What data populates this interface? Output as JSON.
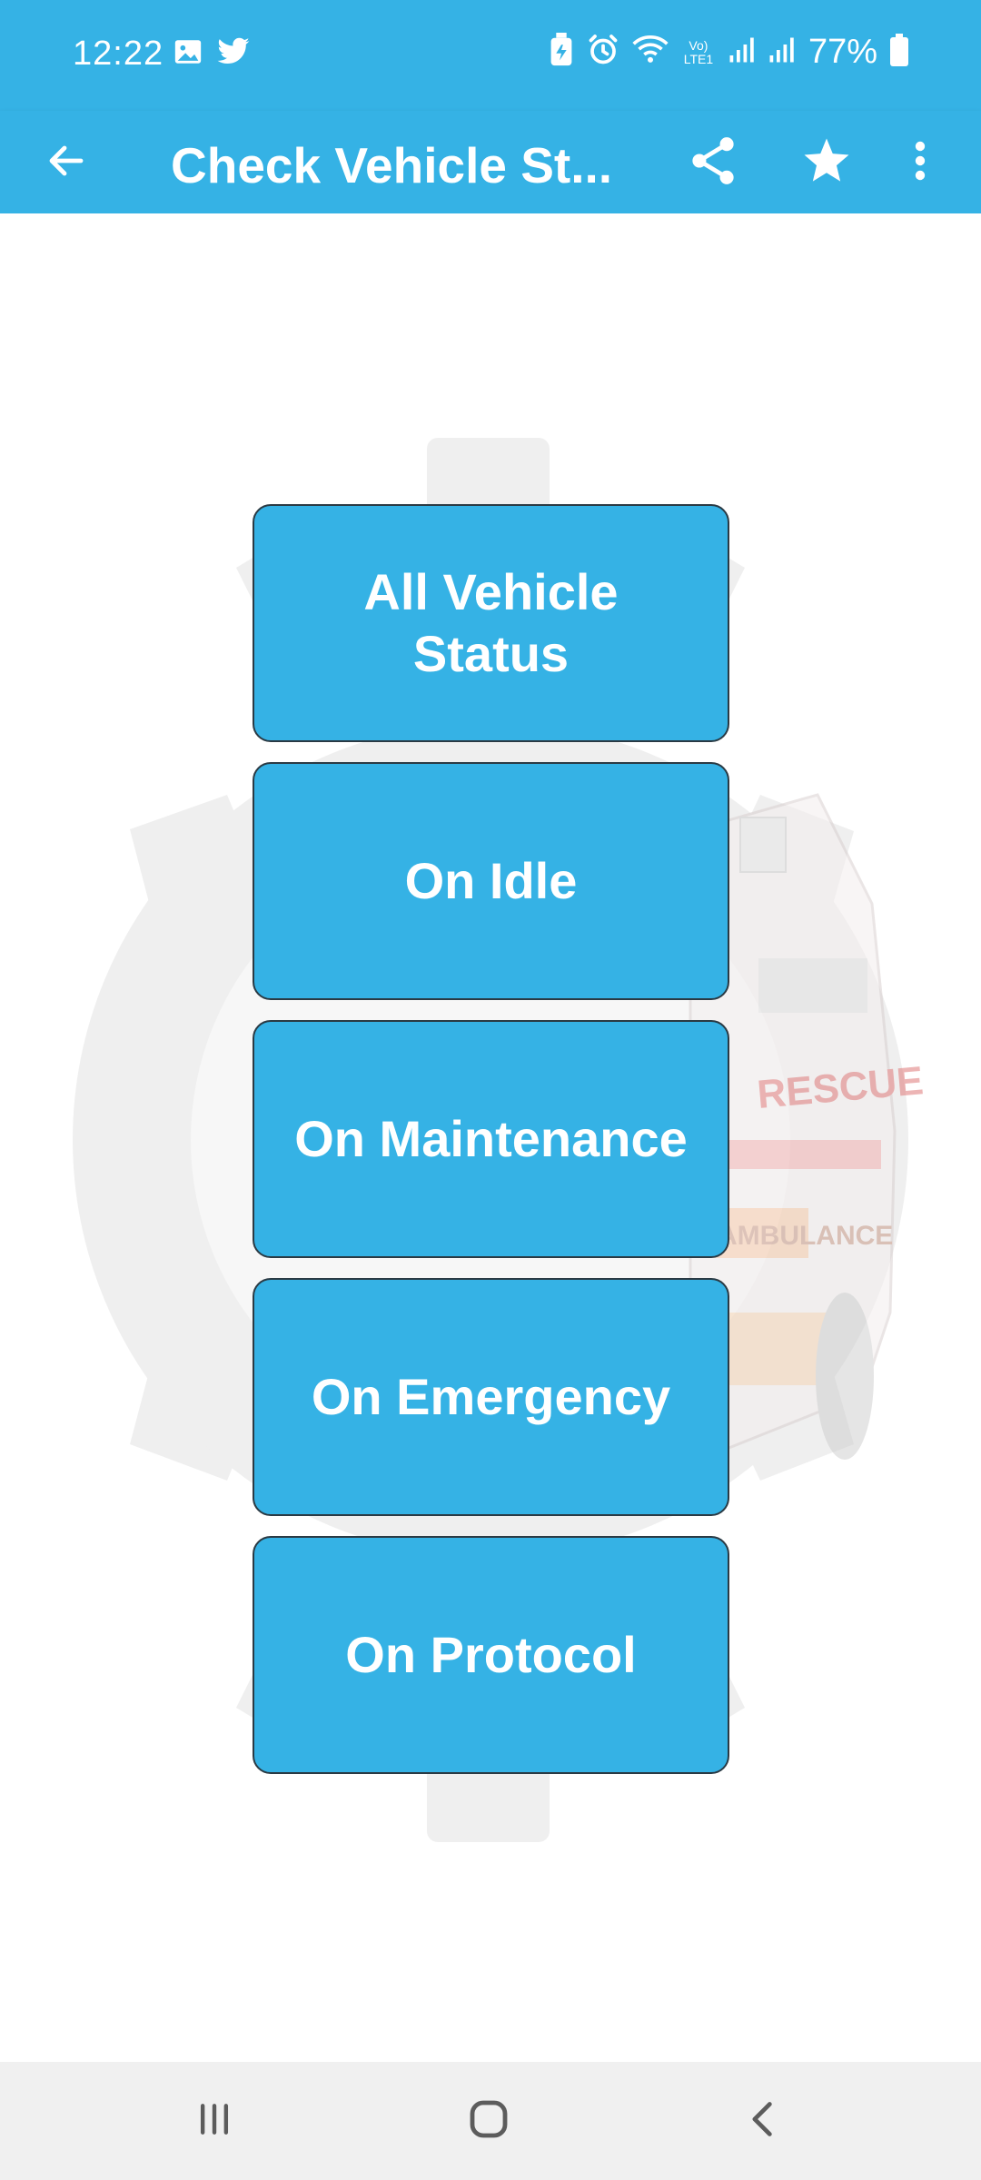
{
  "status_bar": {
    "time": "12:22",
    "battery": "77%",
    "network": "Vo) LTE1"
  },
  "app_bar": {
    "title": "Check Vehicle St...",
    "icons": [
      "arrow-left-icon",
      "share-icon",
      "star-icon",
      "more-vertical-icon"
    ]
  },
  "background": {
    "van_text_1": "RESCUE",
    "van_text_2": "AMBULANCE"
  },
  "status_buttons": [
    {
      "label": "All Vehicle Status"
    },
    {
      "label": "On Idle"
    },
    {
      "label": "On Maintenance"
    },
    {
      "label": "On Emergency"
    },
    {
      "label": "On Protocol"
    }
  ],
  "nav_bar": {
    "icons": [
      "recents-icon",
      "home-icon",
      "back-icon"
    ]
  },
  "colors": {
    "primary": "#35b2e5",
    "background": "#ffffff",
    "nav_bar": "#f0f0f0",
    "button_border": "#2a3a44"
  }
}
